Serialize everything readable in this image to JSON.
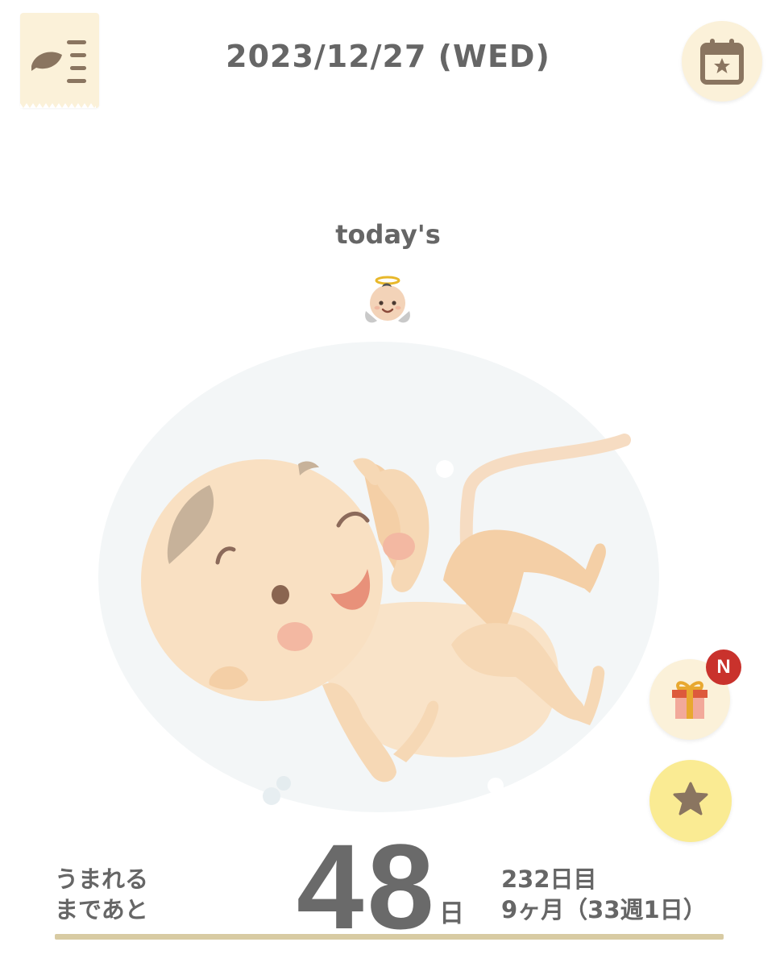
{
  "header": {
    "date": "2023/12/27 (WED)",
    "menu_icon": "leaf-menu-icon",
    "calendar_icon": "calendar-star-icon"
  },
  "today": {
    "label": "today's",
    "emoji_icon": "angel-baby-icon"
  },
  "illustration": "fetus-in-womb",
  "floating_buttons": {
    "gift_icon": "gift-icon",
    "gift_badge": "N",
    "favorite_icon": "star-icon"
  },
  "footer": {
    "until_line1": "うまれる",
    "until_line2": "まであと",
    "days": "48",
    "days_unit": "日",
    "day_count": "232日目",
    "month_week": "9ヶ月（33週1日）"
  },
  "colors": {
    "cream": "#fbf1d9",
    "yellow": "#faeb93",
    "brown": "#8a7560",
    "badge_red": "#c9322c",
    "line": "#d8cba3"
  }
}
